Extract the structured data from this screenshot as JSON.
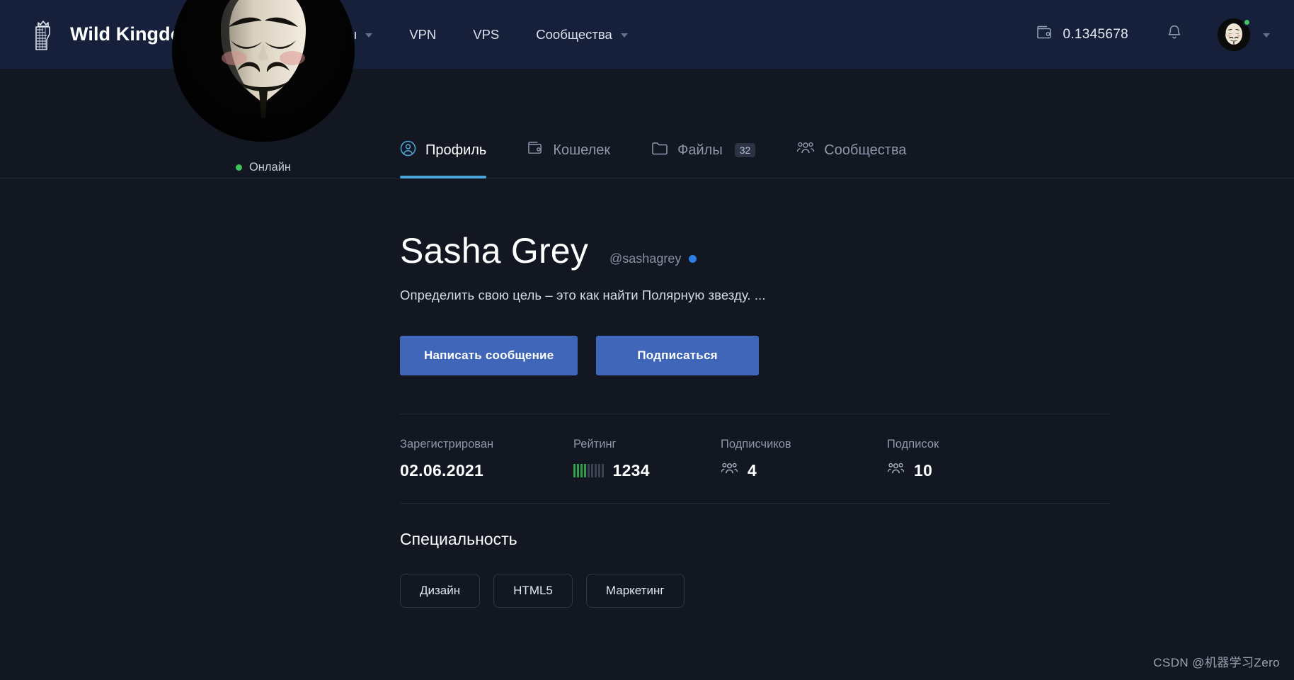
{
  "header": {
    "brand": "Wild Kingdom",
    "logo_icon": "crowned-lion-head-logo",
    "nav": [
      {
        "label": "Файлы",
        "has_dropdown": true
      },
      {
        "label": "VPN",
        "has_dropdown": false
      },
      {
        "label": "VPS",
        "has_dropdown": false
      },
      {
        "label": "Сообщества",
        "has_dropdown": true
      }
    ],
    "wallet": {
      "icon": "wallet-icon",
      "balance": "0.1345678"
    },
    "notifications_icon": "bell-icon",
    "account": {
      "avatar_icon": "guy-fawkes-mask-avatar",
      "online": true,
      "caret_icon": "chevron-down-icon"
    }
  },
  "tabs": [
    {
      "label": "Профиль",
      "icon": "user-circle-icon",
      "active": true,
      "badge": null
    },
    {
      "label": "Кошелек",
      "icon": "wallet-icon",
      "active": false,
      "badge": null
    },
    {
      "label": "Файлы",
      "icon": "folder-icon",
      "active": false,
      "badge": "32"
    },
    {
      "label": "Сообщества",
      "icon": "group-icon",
      "active": false,
      "badge": null
    }
  ],
  "profile": {
    "avatar_icon": "guy-fawkes-mask-avatar",
    "status_label": "Онлайн",
    "display_name": "Sasha Grey",
    "handle": "@sashagrey",
    "verified": true,
    "bio": "Определить свою цель – это как найти Полярную звезду. ...",
    "actions": {
      "message": "Написать сообщение",
      "follow": "Подписаться"
    },
    "stats": [
      {
        "label": "Зарегистрирован",
        "value": "02.06.2021",
        "icon": null,
        "rating": null
      },
      {
        "label": "Рейтинг",
        "value": "1234",
        "icon": null,
        "rating": {
          "filled": 4,
          "total": 9
        }
      },
      {
        "label": "Подписчиков",
        "value": "4",
        "icon": "group-icon",
        "rating": null
      },
      {
        "label": "Подписок",
        "value": "10",
        "icon": "group-icon",
        "rating": null
      }
    ],
    "specialty_title": "Специальность",
    "specialty_tags": [
      "Дизайн",
      "HTML5",
      "Маркетинг"
    ]
  },
  "watermark": "CSDN @机器学习Zero",
  "colors": {
    "header_bg": "#16203a",
    "page_bg": "#121722",
    "accent_tab": "#48a5d6",
    "button_blue": "#3f66b8",
    "online_green": "#3fc45c",
    "verified_blue": "#2f7fe8",
    "rating_green": "#2e9e4c"
  }
}
